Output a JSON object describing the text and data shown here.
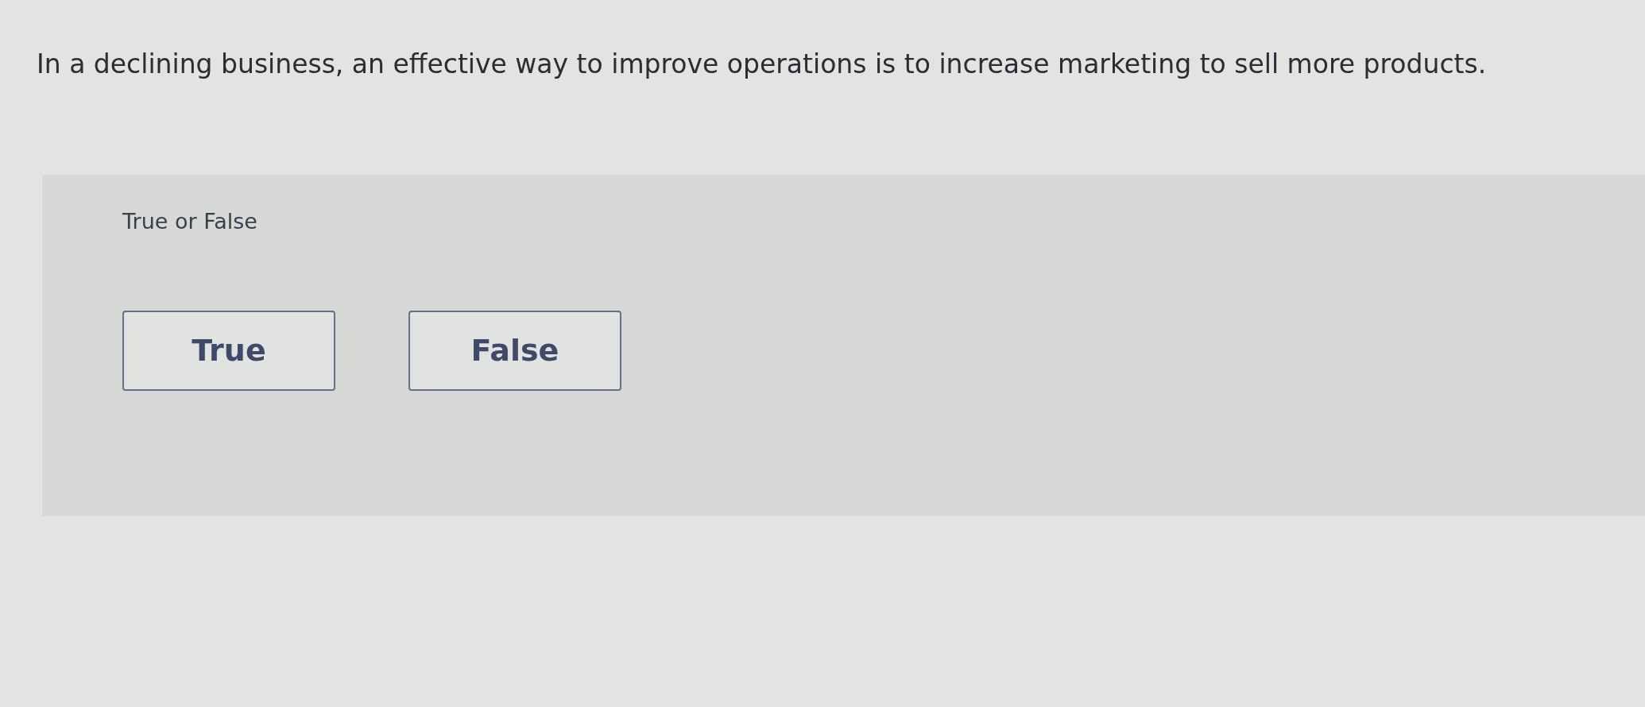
{
  "question": {
    "text": "In a declining business, an effective way to improve operations is to increase marketing to sell more products."
  },
  "answer_panel": {
    "prompt": "True or False",
    "choices": [
      {
        "label": "True",
        "selected": false
      },
      {
        "label": "False",
        "selected": false
      }
    ]
  }
}
